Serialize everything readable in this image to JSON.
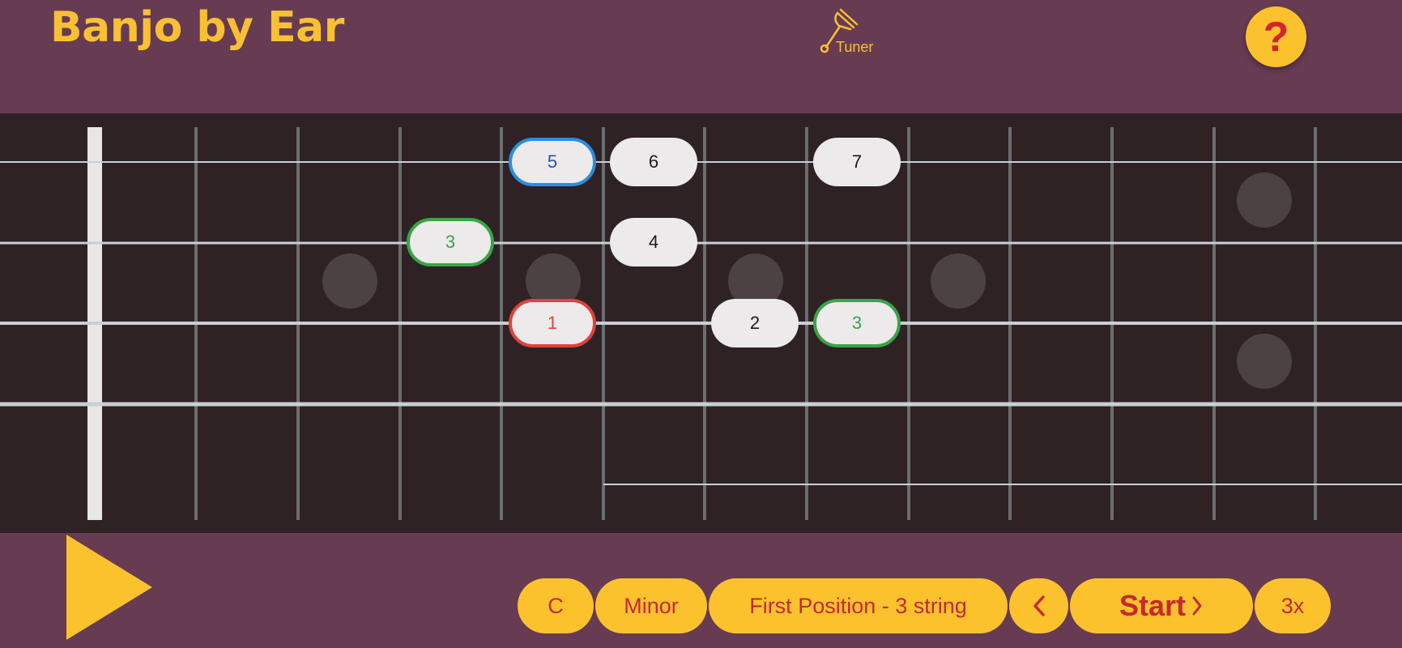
{
  "header": {
    "title": "Banjo by Ear",
    "tuner_label": "Tuner",
    "help_label": "?"
  },
  "fretboard": {
    "notes": [
      {
        "label": "5",
        "string": 1,
        "fret": 5,
        "style": "blue"
      },
      {
        "label": "6",
        "string": 1,
        "fret": 6,
        "style": "plain"
      },
      {
        "label": "7",
        "string": 1,
        "fret": 8,
        "style": "plain"
      },
      {
        "label": "3",
        "string": 2,
        "fret": 4,
        "style": "green"
      },
      {
        "label": "4",
        "string": 2,
        "fret": 6,
        "style": "plain"
      },
      {
        "label": "1",
        "string": 3,
        "fret": 5,
        "style": "red"
      },
      {
        "label": "2",
        "string": 3,
        "fret": 7,
        "style": "plain"
      },
      {
        "label": "3",
        "string": 3,
        "fret": 8,
        "style": "green"
      }
    ]
  },
  "controls": {
    "key": "C",
    "scale": "Minor",
    "pattern": "First Position - 3 string",
    "prev_icon": "chevron-left-icon",
    "start_label": "Start",
    "speed": "3x"
  },
  "colors": {
    "background": "#673b52",
    "fretboard": "#2f2224",
    "accent": "#fbc22e",
    "accent_text": "#c8282e"
  }
}
